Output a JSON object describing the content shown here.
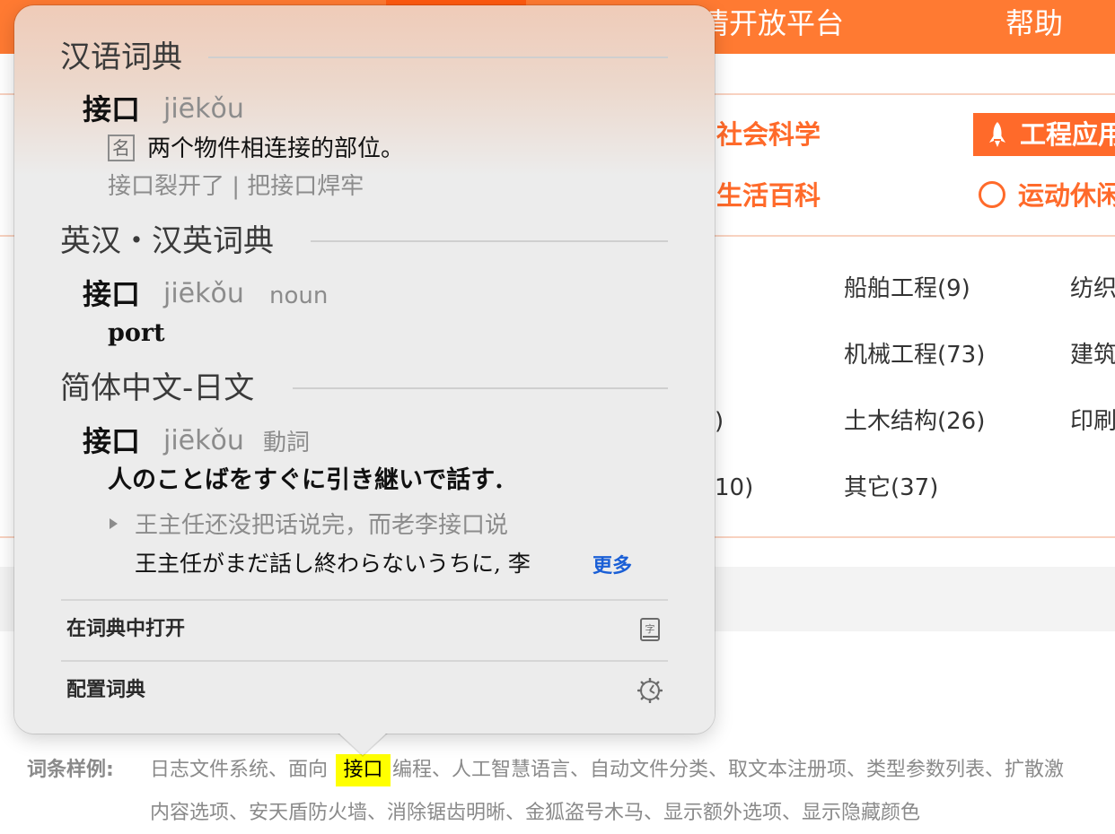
{
  "nav": {
    "items": [
      "情开放平台",
      "帮助"
    ]
  },
  "categories": {
    "row1": [
      "社会科学",
      "工程应用"
    ],
    "row2": [
      "生活百科",
      "运动休闲"
    ]
  },
  "subcategories": {
    "col1": [
      "船舶工程(9)",
      "机械工程(73)",
      "土木结构(26)",
      "其它(37)"
    ],
    "col2": [
      "纺织",
      "建筑",
      "印刷"
    ],
    "col0_partial": [
      ")",
      "10)"
    ]
  },
  "examples": {
    "label": "词条样例:",
    "line1_before": "日志文件系统、面向",
    "highlight": "接口",
    "line1_after": "编程、人工智慧语言、自动文件分类、取文本注册项、类型参数列表、扩散激",
    "line2": "内容选项、安天盾防火墙、消除锯齿明晰、金狐盗号木马、显示额外选项、显示隐藏颜色"
  },
  "popover": {
    "sections": [
      {
        "title": "汉语词典",
        "headword": "接口",
        "pinyin": "jiēkǒu",
        "pos_badge": "名",
        "definition": "两个物件相连接的部位。",
        "example": "接口裂开了 | 把接口焊牢"
      },
      {
        "title": "英汉・汉英词典",
        "headword": "接口",
        "pinyin": "jiēkǒu",
        "pos": "noun",
        "definition": "port"
      },
      {
        "title": "简体中文-日文",
        "headword": "接口",
        "pinyin": "jiēkǒu",
        "pos": "動詞",
        "definition": "人のことばをすぐに引き継いで話す.",
        "example_zh": "王主任还没把话说完，而老李接口说",
        "example_ja": "王主任がまだ話し終わらないうちに, 李",
        "more": "更多"
      }
    ],
    "footer": {
      "open_in_dictionary": "在词典中打开",
      "configure": "配置词典"
    }
  },
  "colors": {
    "brand": "#ff7a32",
    "brand_active": "#ff5a10",
    "highlight": "#ffff00",
    "link": "#1a5fd6"
  },
  "icons": {
    "dictionary": "dictionary-book-icon",
    "settings": "gear-icon",
    "rocket": "rocket-icon",
    "ball": "basketball-icon",
    "disclosure": "disclosure-triangle-icon"
  }
}
